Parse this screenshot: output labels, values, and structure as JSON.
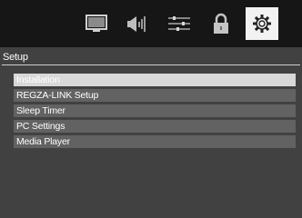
{
  "tabs": [
    {
      "icon": "picture-icon",
      "active": false
    },
    {
      "icon": "sound-icon",
      "active": false
    },
    {
      "icon": "preferences-icon",
      "active": false
    },
    {
      "icon": "lock-icon",
      "active": false
    },
    {
      "icon": "gear-icon",
      "active": true
    }
  ],
  "section": {
    "title": "Setup"
  },
  "menu": {
    "items": [
      {
        "label": "Installation"
      },
      {
        "label": "REGZA-LINK Setup"
      },
      {
        "label": "Sleep Timer"
      },
      {
        "label": "PC Settings"
      },
      {
        "label": "Media Player"
      }
    ],
    "selected_index": 0
  },
  "colors": {
    "background": "#3a3a3a",
    "topbar": "#101010",
    "menu_item": "#5b5b5b",
    "selected_item": "#d8d8d8",
    "active_tab": "#f2f2f2"
  }
}
